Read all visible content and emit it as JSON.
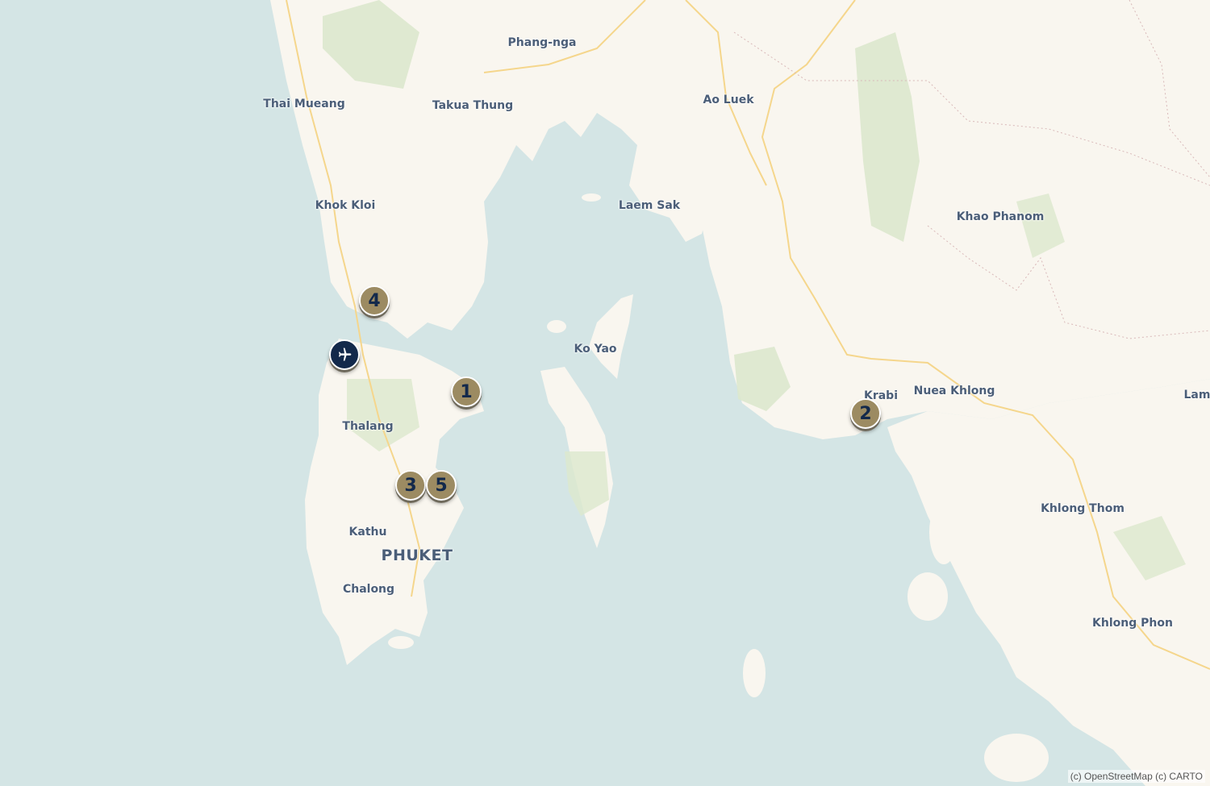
{
  "map": {
    "places": [
      {
        "name": "Phang-nga"
      },
      {
        "name": "Thai Mueang"
      },
      {
        "name": "Takua Thung"
      },
      {
        "name": "Ao Luek"
      },
      {
        "name": "Khok Kloi"
      },
      {
        "name": "Laem Sak"
      },
      {
        "name": "Khao Phanom"
      },
      {
        "name": "Ko Yao"
      },
      {
        "name": "Krabi"
      },
      {
        "name": "Nuea Khlong"
      },
      {
        "name": "Lam"
      },
      {
        "name": "Thalang"
      },
      {
        "name": "Khlong Thom"
      },
      {
        "name": "Kathu"
      },
      {
        "name": "PHUKET"
      },
      {
        "name": "Chalong"
      },
      {
        "name": "Khlong Phon"
      }
    ],
    "markers": [
      {
        "label": "1"
      },
      {
        "label": "2"
      },
      {
        "label": "3"
      },
      {
        "label": "4"
      },
      {
        "label": "5"
      }
    ],
    "airport_icon": "airplane-icon",
    "colors": {
      "water": "#d4e5e5",
      "land": "#f9f6ef",
      "park": "#dce8cd",
      "road": "#f5d68c",
      "marker": "#9c8b62",
      "marker_text": "#13294b",
      "airport": "#13294b"
    }
  },
  "attribution": "(c) OpenStreetMap  (c) CARTO"
}
